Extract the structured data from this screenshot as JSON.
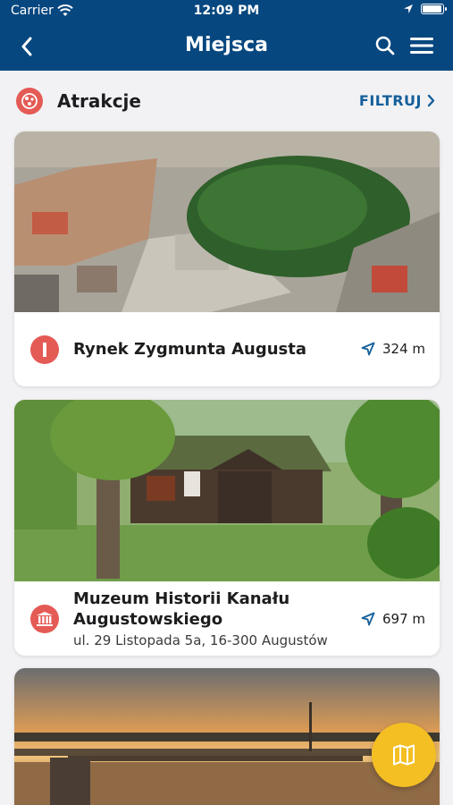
{
  "status": {
    "carrier": "Carrier",
    "time": "12:09 PM",
    "battery_level": 0.95
  },
  "nav": {
    "title": "Miejsca"
  },
  "section": {
    "title": "Atrakcje",
    "filter_label": "FILTRUJ"
  },
  "places": [
    {
      "name": "Rynek Zygmunta Augusta",
      "address": "",
      "distance": "324 m",
      "icon": "info-icon"
    },
    {
      "name_line1": "Muzeum Historii Kanału",
      "name_line2": "Augustowskiego",
      "address": "ul. 29 Listopada 5a, 16-300 Augustów",
      "distance": "697 m",
      "icon": "museum-icon"
    },
    {
      "name": "",
      "address": "",
      "distance": "",
      "icon": ""
    }
  ],
  "colors": {
    "brand": "#07477f",
    "accent_red": "#e45a55",
    "fab": "#f4bf23",
    "link": "#145f9b"
  },
  "fab": {
    "icon": "map-icon"
  }
}
